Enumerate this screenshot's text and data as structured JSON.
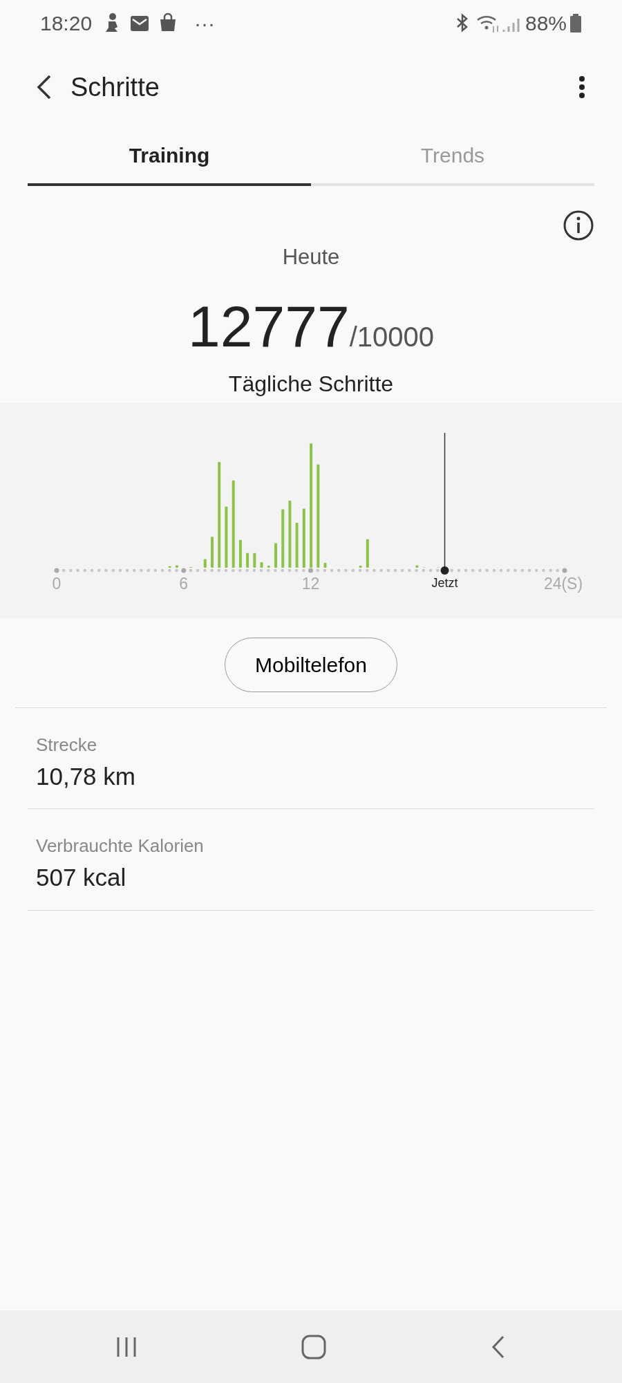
{
  "status_bar": {
    "time": "18:20",
    "more": "···",
    "battery": "88%"
  },
  "header": {
    "title": "Schritte"
  },
  "tabs": [
    {
      "label": "Training",
      "selected": true
    },
    {
      "label": "Trends",
      "selected": false
    }
  ],
  "summary": {
    "caption": "Heute",
    "steps": "12777",
    "goal": "/10000",
    "label": "Tägliche Schritte"
  },
  "chart": {
    "axis_labels": [
      "0",
      "6",
      "12",
      "24(S)"
    ],
    "now_label": "Jetzt"
  },
  "source_button": "Mobiltelefon",
  "stats": [
    {
      "label": "Strecke",
      "value": "10,78 km"
    },
    {
      "label": "Verbrauchte Kalorien",
      "value": "507 kcal"
    }
  ]
}
